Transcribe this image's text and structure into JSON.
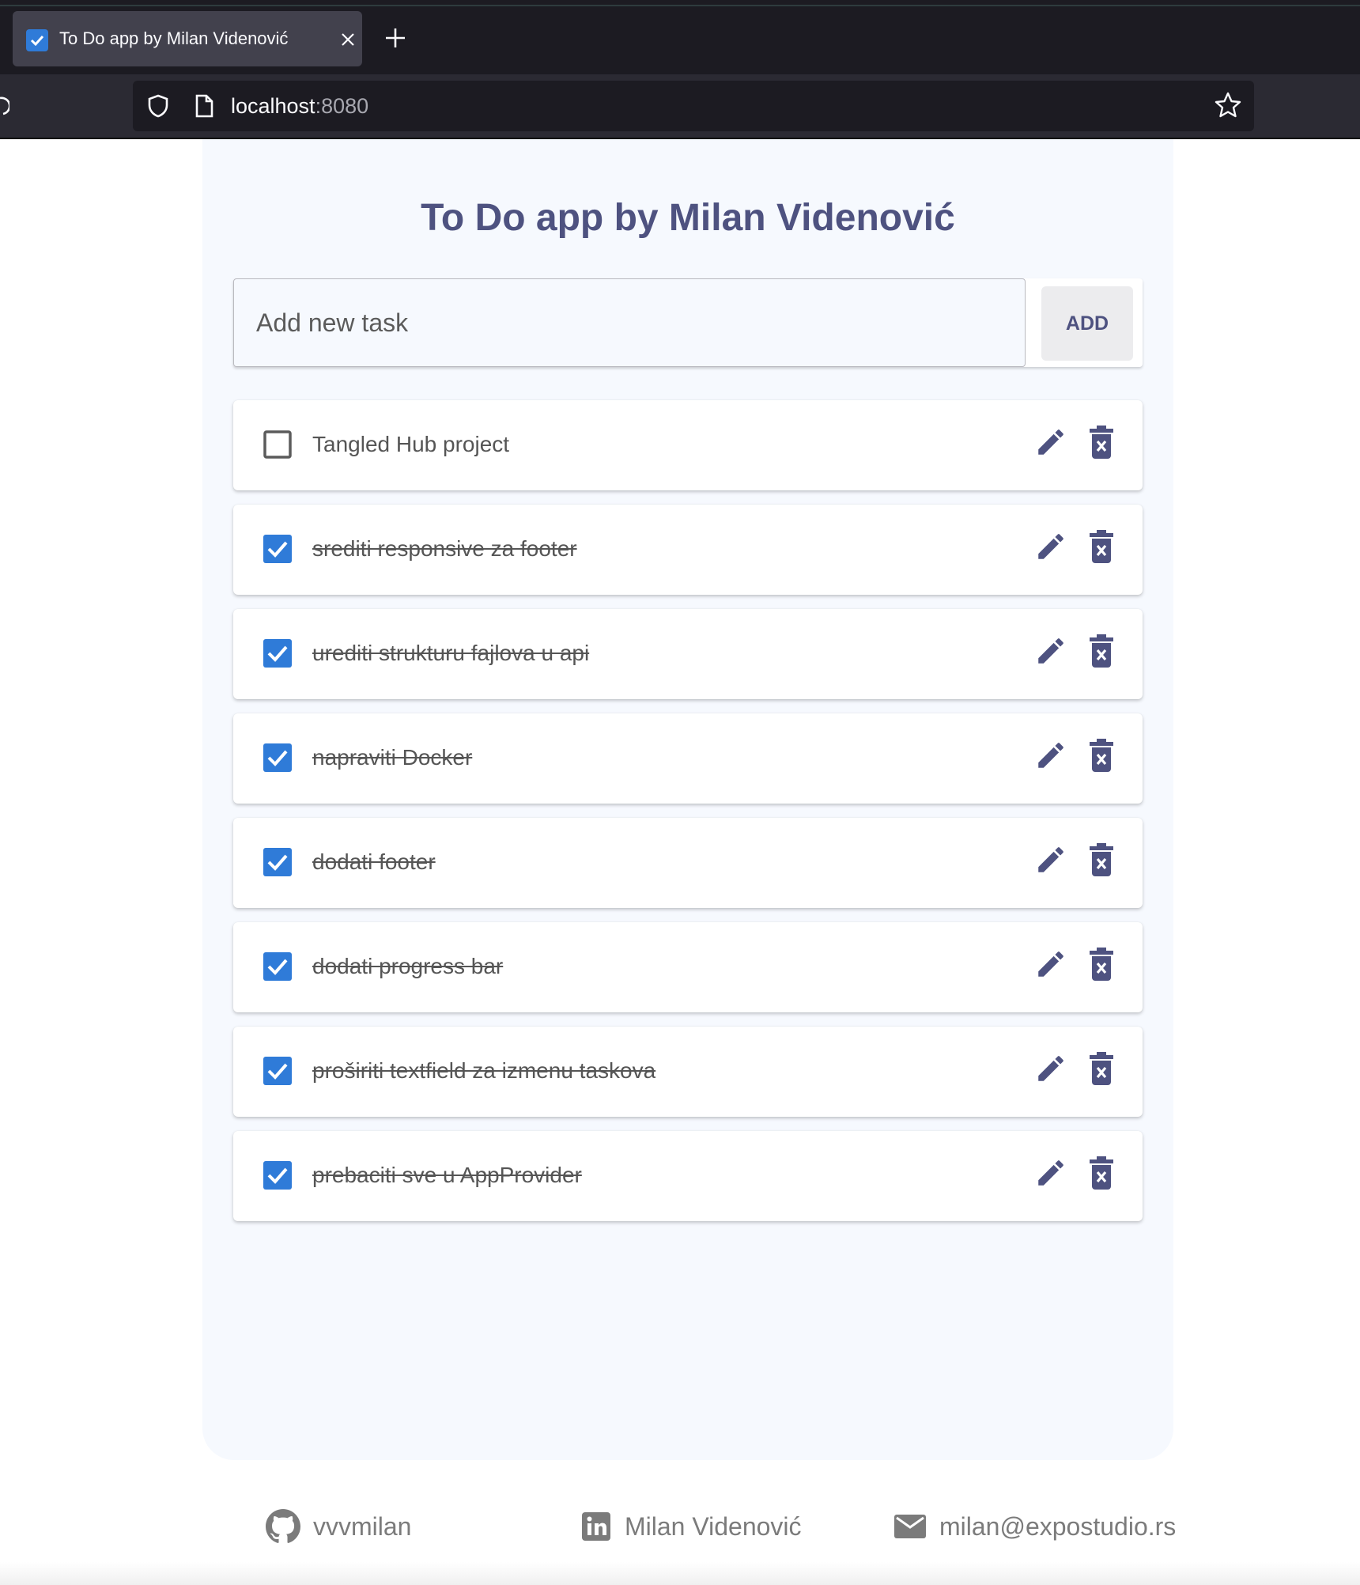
{
  "browser": {
    "tab_title": "To Do app by Milan Videnović",
    "url_host": "localhost",
    "url_port": ":8080"
  },
  "app": {
    "title": "To Do app by Milan Videnović",
    "input_placeholder": "Add new task",
    "add_label": "ADD",
    "accent_color": "#4e5280",
    "checkbox_color": "#2f7bd8"
  },
  "tasks": [
    {
      "label": "Tangled Hub project",
      "done": false
    },
    {
      "label": "srediti responsive za footer",
      "done": true
    },
    {
      "label": "urediti strukturu fajlova u api",
      "done": true
    },
    {
      "label": "napraviti Docker",
      "done": true
    },
    {
      "label": "dodati footer",
      "done": true
    },
    {
      "label": "dodati progress bar",
      "done": true
    },
    {
      "label": "proširiti textfield za izmenu taskova",
      "done": true
    },
    {
      "label": "prebaciti sve u AppProvider",
      "done": true
    }
  ],
  "footer": {
    "github": "vvvmilan",
    "linkedin": "Milan Videnović",
    "email": "milan@expostudio.rs"
  }
}
